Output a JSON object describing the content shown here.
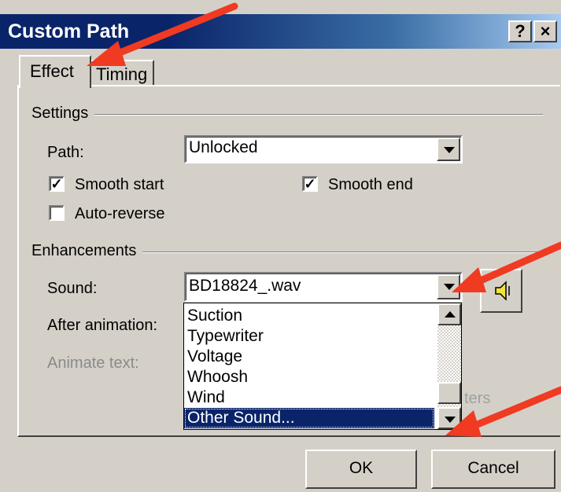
{
  "window": {
    "title": "Custom Path",
    "help_button": "?",
    "close_button": "×"
  },
  "tabs": {
    "effect": "Effect",
    "timing": "Timing"
  },
  "settings": {
    "group_label": "Settings",
    "path_label": "Path:",
    "path_value": "Unlocked",
    "smooth_start_label": "Smooth start",
    "smooth_start_checked": true,
    "smooth_end_label": "Smooth end",
    "smooth_end_checked": true,
    "auto_reverse_label": "Auto-reverse",
    "auto_reverse_checked": false
  },
  "enhancements": {
    "group_label": "Enhancements",
    "sound_label": "Sound:",
    "sound_value": "BD18824_.wav",
    "after_animation_label": "After animation:",
    "animate_text_label": "Animate text:",
    "partial_hidden_text": "ters"
  },
  "sound_list": {
    "items": [
      "Suction",
      "Typewriter",
      "Voltage",
      "Whoosh",
      "Wind",
      "Other Sound..."
    ],
    "selected_index": 5
  },
  "buttons": {
    "ok": "OK",
    "cancel": "Cancel"
  },
  "icons": {
    "speaker": "speaker-icon",
    "dropdown": "chevron-down-icon",
    "scroll_up": "chevron-up-icon"
  },
  "colors": {
    "title_bar": "#0a246a",
    "face": "#d4d0c8",
    "selection": "#0a246a",
    "annotation_arrow": "#f03a22"
  }
}
